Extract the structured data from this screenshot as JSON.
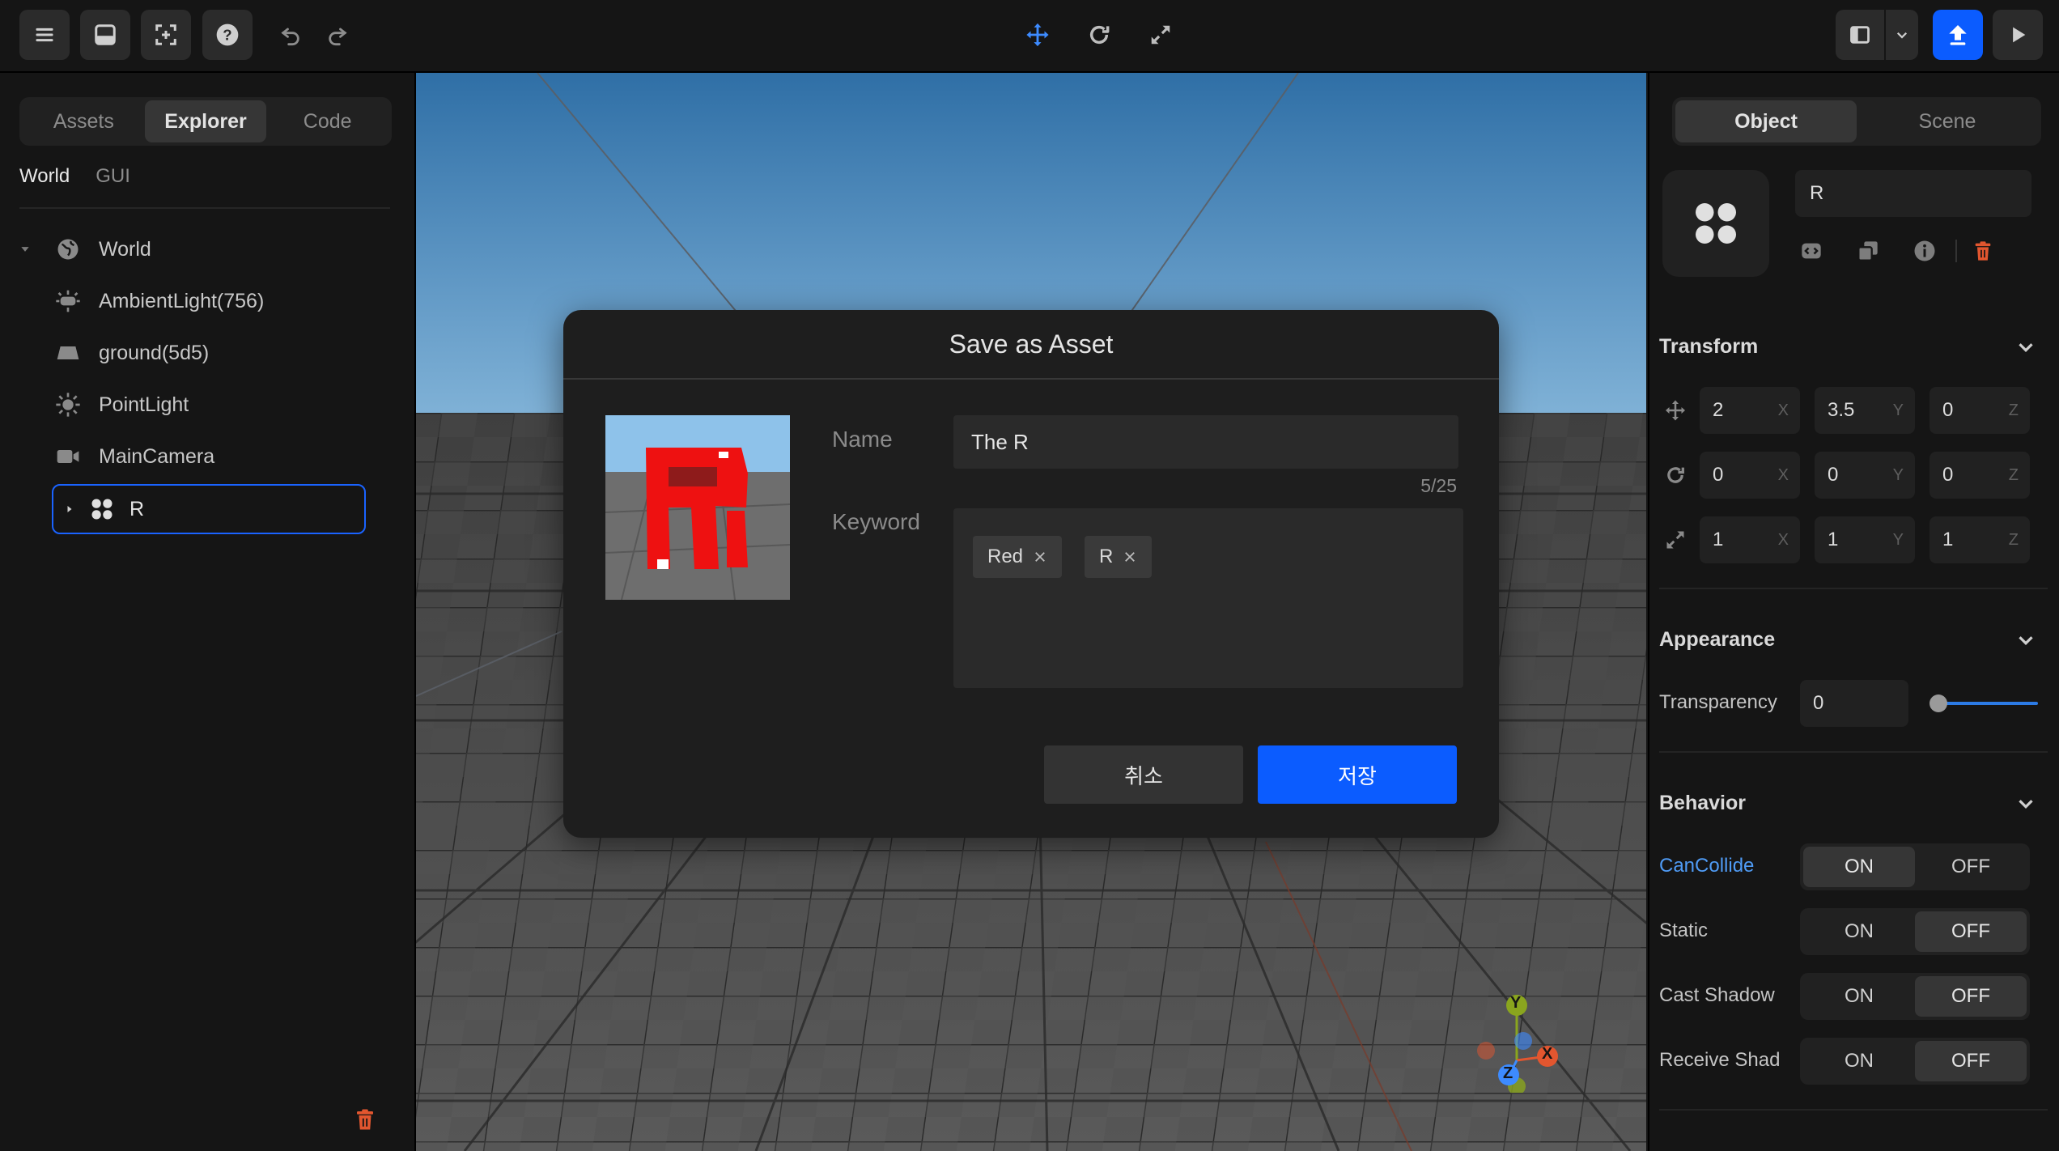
{
  "colors": {
    "accent": "#0b5cff",
    "danger": "#e2562f",
    "link": "#4f9bf5"
  },
  "toolbar": {
    "left_icons": [
      "menu-icon",
      "inbox-icon",
      "fullscreen-select-icon",
      "help-icon",
      "undo-icon",
      "redo-icon"
    ],
    "center_icons": [
      "move-icon",
      "rotate-icon",
      "scale-icon"
    ],
    "right_icons": [
      "panel-layout-icon",
      "chevron-down-icon",
      "publish-icon",
      "play-icon"
    ]
  },
  "left_panel": {
    "tabs": [
      "Assets",
      "Explorer",
      "Code"
    ],
    "active_tab": "Explorer",
    "subtabs": [
      "World",
      "GUI"
    ],
    "tree": [
      {
        "label": "World",
        "icon": "globe-icon"
      },
      {
        "label": "AmbientLight(756)",
        "icon": "ambient-light-icon"
      },
      {
        "label": "ground(5d5)",
        "icon": "ground-icon"
      },
      {
        "label": "PointLight",
        "icon": "point-light-icon"
      },
      {
        "label": "MainCamera",
        "icon": "camera-icon"
      },
      {
        "label": "R",
        "icon": "group-icon"
      }
    ]
  },
  "modal": {
    "title": "Save as Asset",
    "name_label": "Name",
    "name_value": "The R",
    "counter": "5/25",
    "keyword_label": "Keyword",
    "keywords": [
      "Red",
      "R"
    ],
    "cancel": "취소",
    "save": "저장"
  },
  "right_panel": {
    "tabs": [
      "Object",
      "Scene"
    ],
    "active_tab": "Object",
    "object_name": "R",
    "transform": {
      "title": "Transform",
      "position": {
        "x": "2",
        "y": "3.5",
        "z": "0"
      },
      "rotation": {
        "x": "0",
        "y": "0",
        "z": "0"
      },
      "scale": {
        "x": "1",
        "y": "1",
        "z": "1"
      },
      "axes": [
        "X",
        "Y",
        "Z"
      ]
    },
    "appearance": {
      "title": "Appearance",
      "transparency_label": "Transparency",
      "transparency_value": "0",
      "transparency_level": 0
    },
    "behavior": {
      "title": "Behavior",
      "on": "ON",
      "off": "OFF",
      "rows": [
        {
          "label": "CanCollide",
          "state": "ON"
        },
        {
          "label": "Static",
          "state": "OFF"
        },
        {
          "label": "Cast Shadow",
          "state": "OFF"
        },
        {
          "label": "Receive Shad",
          "state": "OFF"
        }
      ]
    }
  },
  "gizmo": {
    "x": "X",
    "y": "Y",
    "z": "Z"
  }
}
